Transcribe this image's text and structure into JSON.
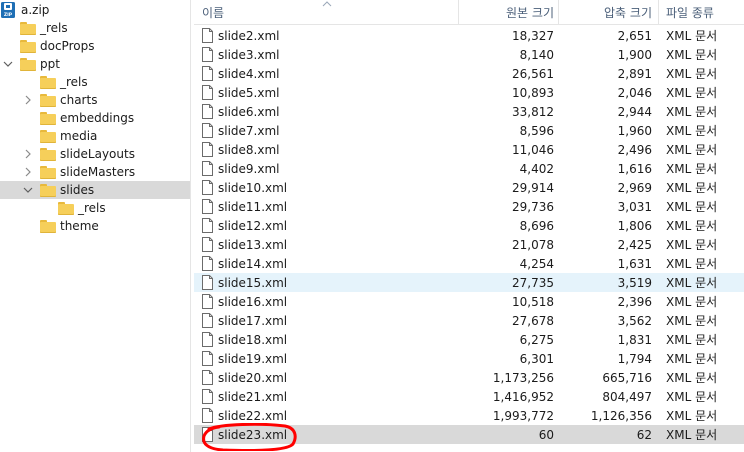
{
  "tree": {
    "root": {
      "label": "a.zip",
      "icon": "zip-icon"
    },
    "nodes": [
      {
        "key": "rels_root",
        "label": "_rels",
        "expander": ""
      },
      {
        "key": "docprops",
        "label": "docProps",
        "expander": ""
      },
      {
        "key": "ppt",
        "label": "ppt",
        "expander": "chevron-down"
      },
      {
        "key": "ppt_rels",
        "label": "_rels",
        "expander": ""
      },
      {
        "key": "charts",
        "label": "charts",
        "expander": "chevron-right"
      },
      {
        "key": "embeddings",
        "label": "embeddings",
        "expander": ""
      },
      {
        "key": "media",
        "label": "media",
        "expander": ""
      },
      {
        "key": "slidelayouts",
        "label": "slideLayouts",
        "expander": "chevron-right"
      },
      {
        "key": "slidemasters",
        "label": "slideMasters",
        "expander": "chevron-right"
      },
      {
        "key": "slides",
        "label": "slides",
        "expander": "chevron-down",
        "selected": true
      },
      {
        "key": "slides_rels",
        "label": "_rels",
        "expander": ""
      },
      {
        "key": "theme",
        "label": "theme",
        "expander": ""
      }
    ]
  },
  "columns": {
    "name": "이름",
    "original_size": "원본 크기",
    "compressed_size": "압축 크기",
    "type": "파일 종류"
  },
  "files": [
    {
      "name": "slide2.xml",
      "original": "18,327",
      "compressed": "2,651",
      "type": "XML 문서"
    },
    {
      "name": "slide3.xml",
      "original": "8,140",
      "compressed": "1,900",
      "type": "XML 문서"
    },
    {
      "name": "slide4.xml",
      "original": "26,561",
      "compressed": "2,891",
      "type": "XML 문서"
    },
    {
      "name": "slide5.xml",
      "original": "10,893",
      "compressed": "2,046",
      "type": "XML 문서"
    },
    {
      "name": "slide6.xml",
      "original": "33,812",
      "compressed": "2,944",
      "type": "XML 문서"
    },
    {
      "name": "slide7.xml",
      "original": "8,596",
      "compressed": "1,960",
      "type": "XML 문서"
    },
    {
      "name": "slide8.xml",
      "original": "11,046",
      "compressed": "2,496",
      "type": "XML 문서"
    },
    {
      "name": "slide9.xml",
      "original": "4,402",
      "compressed": "1,616",
      "type": "XML 문서"
    },
    {
      "name": "slide10.xml",
      "original": "29,914",
      "compressed": "2,969",
      "type": "XML 문서"
    },
    {
      "name": "slide11.xml",
      "original": "29,736",
      "compressed": "3,031",
      "type": "XML 문서"
    },
    {
      "name": "slide12.xml",
      "original": "8,696",
      "compressed": "1,806",
      "type": "XML 문서"
    },
    {
      "name": "slide13.xml",
      "original": "21,078",
      "compressed": "2,425",
      "type": "XML 문서"
    },
    {
      "name": "slide14.xml",
      "original": "4,254",
      "compressed": "1,631",
      "type": "XML 문서"
    },
    {
      "name": "slide15.xml",
      "original": "27,735",
      "compressed": "3,519",
      "type": "XML 문서",
      "state": "hover"
    },
    {
      "name": "slide16.xml",
      "original": "10,518",
      "compressed": "2,396",
      "type": "XML 문서"
    },
    {
      "name": "slide17.xml",
      "original": "27,678",
      "compressed": "3,562",
      "type": "XML 문서"
    },
    {
      "name": "slide18.xml",
      "original": "6,275",
      "compressed": "1,831",
      "type": "XML 문서"
    },
    {
      "name": "slide19.xml",
      "original": "6,301",
      "compressed": "1,794",
      "type": "XML 문서"
    },
    {
      "name": "slide20.xml",
      "original": "1,173,256",
      "compressed": "665,716",
      "type": "XML 문서"
    },
    {
      "name": "slide21.xml",
      "original": "1,416,952",
      "compressed": "804,497",
      "type": "XML 문서"
    },
    {
      "name": "slide22.xml",
      "original": "1,993,772",
      "compressed": "1,126,356",
      "type": "XML 문서"
    },
    {
      "name": "slide23.xml",
      "original": "60",
      "compressed": "62",
      "type": "XML 문서",
      "state": "selected",
      "annotated": true
    }
  ],
  "colors": {
    "folder": "#f6cf5a",
    "selection": "#d9d9d9",
    "hover": "#e5f3fb",
    "header_text": "#4c607a",
    "annotation": "#ff0000"
  }
}
